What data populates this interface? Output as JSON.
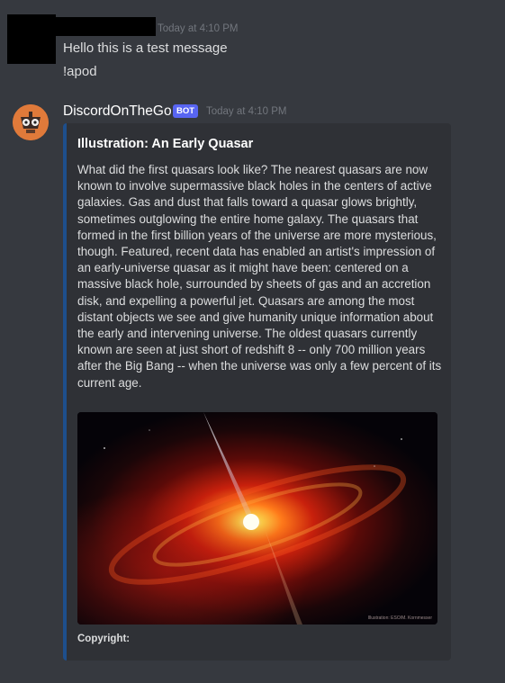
{
  "message1": {
    "timestamp": "Today at 4:10 PM",
    "lines": [
      "Hello this is a test message",
      "!apod"
    ]
  },
  "message2": {
    "username": "DiscordOnTheGo",
    "badge": "BOT",
    "timestamp": "Today at 4:10 PM",
    "avatar_icon": "robot-face-icon",
    "embed": {
      "accent_color": "#1e4f8c",
      "title": "Illustration: An Early Quasar",
      "description": "What did the first quasars look like? The nearest quasars are now known to involve supermassive black holes in the centers of active galaxies. Gas and dust that falls toward a quasar glows brightly, sometimes outglowing the entire home galaxy. The quasars that formed in the first billion years of the universe are more mysterious, though. Featured, recent data has enabled an artist's impression of an early-universe quasar as it might have been: centered on a massive black hole, surrounded by sheets of gas and an accretion disk, and expelling a powerful jet. Quasars are among the most distant objects we see and give humanity unique information about the early and intervening universe. The oldest quasars currently known are seen at just short of redshift 8 -- only 700 million years after the Big Bang -- when the universe was only a few percent of its current age.",
      "image_credit": "Illustration: ESO/M. Kornmesser",
      "footer": "Copyright:"
    }
  }
}
